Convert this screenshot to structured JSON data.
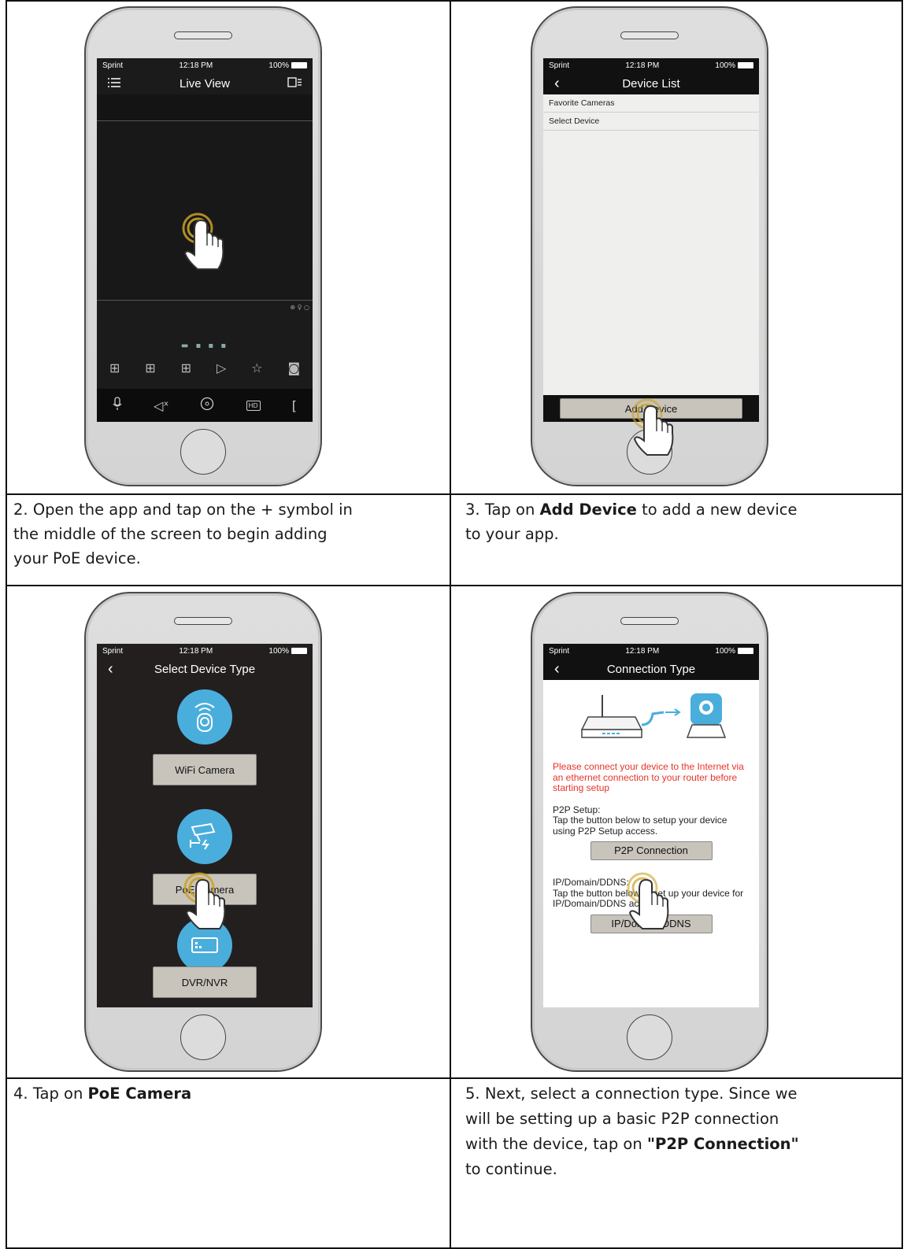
{
  "phones": {
    "live_view": {
      "status": {
        "carrier": "Sprint",
        "time": "12:18 PM",
        "battery": "100%"
      },
      "title": "Live View",
      "icons": [
        "menu-icon",
        "layout-icon",
        "zoom-icon",
        "mic-icon",
        "mute-icon",
        "ptz-icon",
        "hd-icon",
        "more-icon",
        "playback-icon",
        "favorite-icon",
        "snapshot-icon"
      ],
      "hd_label": "HD"
    },
    "device_list": {
      "status": {
        "carrier": "Sprint",
        "time": "12:18 PM",
        "battery": "100%"
      },
      "title": "Device List",
      "rows": [
        "Favorite Cameras",
        "Select Device"
      ],
      "add_button": "Add Device"
    },
    "select_device_type": {
      "status": {
        "carrier": "Sprint",
        "time": "12:18 PM",
        "battery": "100%"
      },
      "title": "Select Device Type",
      "options": [
        "WiFi Camera",
        "PoE Camera",
        "DVR/NVR"
      ]
    },
    "connection_type": {
      "status": {
        "carrier": "Sprint",
        "time": "12:18 PM",
        "battery": "100%"
      },
      "title": "Connection Type",
      "warning": "Please connect your device to the Internet via an ethernet connection to your router before starting setup",
      "p2p_heading": "P2P Setup:",
      "p2p_text": "Tap the button below to setup your device using P2P Setup access.",
      "p2p_button": "P2P Connection",
      "ip_heading": "IP/Domain/DDNS:",
      "ip_text": "Tap the button below to set up your device for IP/Domain/DDNS access.",
      "ip_button": "IP/Domain/DDNS"
    }
  },
  "steps": {
    "step2": {
      "number": "2.",
      "text": "Open the app and tap on the + symbol in",
      "text2": "the middle of the screen to begin adding",
      "text3": "your PoE device."
    },
    "step3": {
      "number": "3.",
      "pre": "Tap on",
      "bold": "Add Device",
      "post": "to add a new device",
      "text2": "to your app."
    },
    "step4": {
      "number": "4.",
      "pre": "Tap on",
      "bold": "PoE Camera"
    },
    "step5": {
      "number": "5.",
      "text": "Next, select a connection type. Since we",
      "text2": "will be setting up a basic P2P connection",
      "pre3": "with the device, tap on",
      "bold3": "\"P2P Connection\"",
      "text4": "to continue."
    }
  },
  "colors": {
    "accent_blue": "#4aaedc",
    "warning_red": "#e8322a",
    "tap_gold": "#c9a227"
  }
}
